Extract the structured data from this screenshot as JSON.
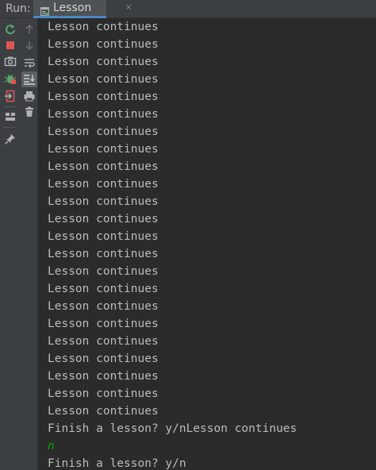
{
  "header": {
    "run_label": "Run:",
    "tab": {
      "label": "Lesson",
      "icon": "console-icon",
      "close_glyph": "×"
    }
  },
  "toolbar": {
    "left": [
      {
        "name": "rerun-icon",
        "color": "#59a869"
      },
      {
        "name": "stop-icon",
        "color": "#e05555"
      },
      {
        "name": "camera-icon",
        "color": "#afb1b3"
      },
      {
        "name": "debug-icon",
        "color": "#59a869"
      },
      {
        "name": "exit-icon",
        "color": "#e05555"
      },
      {
        "name": "layout-icon",
        "color": "#afb1b3"
      },
      {
        "name": "pin-icon",
        "color": "#afb1b3"
      }
    ],
    "right": [
      {
        "name": "arrow-up-icon",
        "color": "#6e6e6e"
      },
      {
        "name": "arrow-down-icon",
        "color": "#6e6e6e"
      },
      {
        "name": "soft-wrap-icon",
        "color": "#afb1b3"
      },
      {
        "name": "scroll-to-end-icon",
        "color": "#afb1b3"
      },
      {
        "name": "print-icon",
        "color": "#afb1b3"
      },
      {
        "name": "trash-icon",
        "color": "#afb1b3"
      }
    ]
  },
  "console": {
    "lines": [
      {
        "text": "Lesson continues",
        "kind": "output"
      },
      {
        "text": "Lesson continues",
        "kind": "output"
      },
      {
        "text": "Lesson continues",
        "kind": "output"
      },
      {
        "text": "Lesson continues",
        "kind": "output"
      },
      {
        "text": "Lesson continues",
        "kind": "output"
      },
      {
        "text": "Lesson continues",
        "kind": "output"
      },
      {
        "text": "Lesson continues",
        "kind": "output"
      },
      {
        "text": "Lesson continues",
        "kind": "output"
      },
      {
        "text": "Lesson continues",
        "kind": "output"
      },
      {
        "text": "Lesson continues",
        "kind": "output"
      },
      {
        "text": "Lesson continues",
        "kind": "output"
      },
      {
        "text": "Lesson continues",
        "kind": "output"
      },
      {
        "text": "Lesson continues",
        "kind": "output"
      },
      {
        "text": "Lesson continues",
        "kind": "output"
      },
      {
        "text": "Lesson continues",
        "kind": "output"
      },
      {
        "text": "Lesson continues",
        "kind": "output"
      },
      {
        "text": "Lesson continues",
        "kind": "output"
      },
      {
        "text": "Lesson continues",
        "kind": "output"
      },
      {
        "text": "Lesson continues",
        "kind": "output"
      },
      {
        "text": "Lesson continues",
        "kind": "output"
      },
      {
        "text": "Lesson continues",
        "kind": "output"
      },
      {
        "text": "Lesson continues",
        "kind": "output"
      },
      {
        "text": "Lesson continues",
        "kind": "output"
      },
      {
        "text": "Finish a lesson? y/nLesson continues",
        "kind": "output"
      },
      {
        "text": "n",
        "kind": "input"
      },
      {
        "text": "Finish a lesson? y/n",
        "kind": "output"
      }
    ],
    "colors": {
      "output": "#bbbbbb",
      "input": "#00aa00",
      "background": "#2b2b2b"
    }
  }
}
